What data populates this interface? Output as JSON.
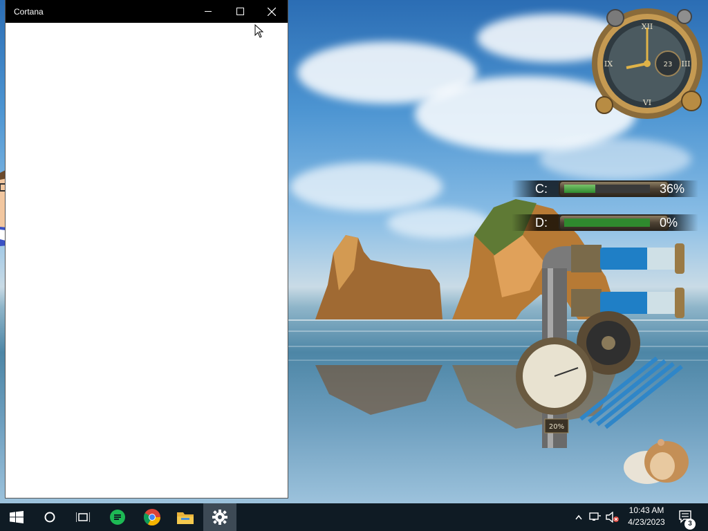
{
  "window": {
    "title": "Cortana",
    "minimize_label": "Minimize",
    "maximize_label": "Maximize",
    "close_label": "Close"
  },
  "desktop": {
    "drives": [
      {
        "letter": "C:",
        "percent_text": "36%",
        "percent": 36
      },
      {
        "letter": "D:",
        "percent_text": "0%",
        "percent": 0
      }
    ],
    "clock": {
      "date_number": "23"
    },
    "gauge": {
      "label": "20%"
    }
  },
  "taskbar": {
    "icons": [
      {
        "name": "start-button",
        "icon": "windows-logo"
      },
      {
        "name": "search-button",
        "icon": "circle"
      },
      {
        "name": "task-view-button",
        "icon": "task-view"
      },
      {
        "name": "app-green-button",
        "icon": "green-app"
      },
      {
        "name": "chrome-button",
        "icon": "chrome"
      },
      {
        "name": "file-explorer-button",
        "icon": "folder"
      },
      {
        "name": "settings-button",
        "icon": "gear"
      }
    ],
    "time": "10:43 AM",
    "date": "4/23/2023",
    "notification_count": "3"
  },
  "colors": {
    "titlebar": "#000000",
    "taskbar": "#0f1b24",
    "active_taskbar_item": "#3d4a55",
    "gauge_fill": "#2f8a2e"
  }
}
